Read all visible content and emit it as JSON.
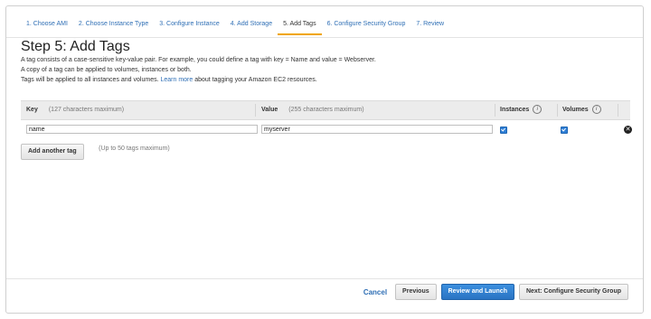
{
  "wizard": {
    "steps": [
      {
        "label": "1. Choose AMI"
      },
      {
        "label": "2. Choose Instance Type"
      },
      {
        "label": "3. Configure Instance"
      },
      {
        "label": "4. Add Storage"
      },
      {
        "label": "5. Add Tags"
      },
      {
        "label": "6. Configure Security Group"
      },
      {
        "label": "7. Review"
      }
    ],
    "active_index": 4
  },
  "page": {
    "title": "Step 5: Add Tags",
    "intro_line1": "A tag consists of a case-sensitive key-value pair. For example, you could define a tag with key = Name and value = Webserver.",
    "intro_line2": "A copy of a tag can be applied to volumes, instances or both.",
    "intro_line3": "Tags will be applied to all instances and volumes.",
    "learn_more": "Learn more",
    "intro_line3_suffix": "about tagging your Amazon EC2 resources."
  },
  "table": {
    "headers": {
      "key": "Key",
      "key_hint": "(127 characters maximum)",
      "value": "Value",
      "value_hint": "(255 characters maximum)",
      "instances": "Instances",
      "volumes": "Volumes"
    },
    "rows": [
      {
        "key": "name",
        "value": "myserver",
        "instances": true,
        "volumes": true
      }
    ]
  },
  "add_tag": {
    "button_label": "Add another tag",
    "hint": "(Up to 50 tags maximum)"
  },
  "footer": {
    "cancel": "Cancel",
    "previous": "Previous",
    "review_launch": "Review and Launch",
    "next": "Next: Configure Security Group"
  },
  "colors": {
    "link": "#2f6fb5",
    "primary_button": "#2a74c3",
    "active_tab_underline": "#f0a500"
  },
  "icons": {
    "info": "info-icon",
    "remove": "remove-tag-icon"
  }
}
